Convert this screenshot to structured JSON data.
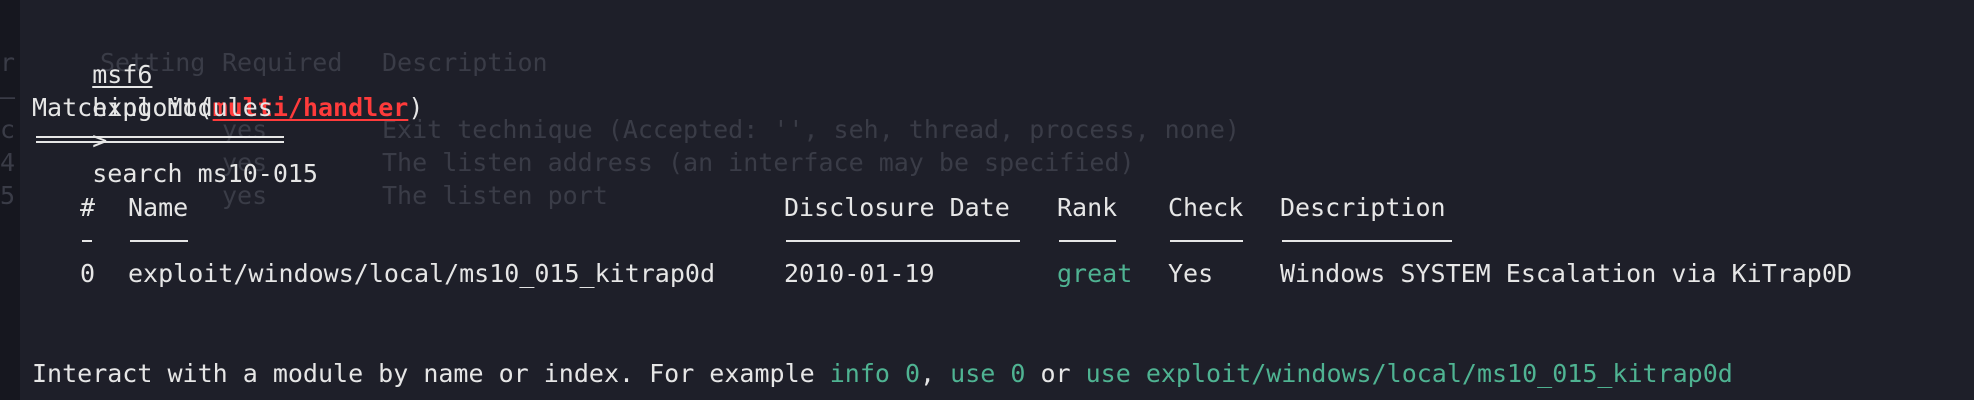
{
  "ghost": {
    "left_chars": [
      "r",
      "—",
      "c",
      "4",
      "5"
    ],
    "h_setting": "Setting",
    "h_required": "Required",
    "h_description": "Description",
    "rows": [
      {
        "req": "yes",
        "desc": "Exit technique (Accepted: '', seh, thread, process, none)"
      },
      {
        "req": "yes",
        "desc": "The listen address (an interface may be specified)"
      },
      {
        "req": "yes",
        "desc": "The listen port"
      }
    ]
  },
  "prompt": {
    "msf": "msf6",
    "exploit_word": "exploit(",
    "module": "multi/handler",
    "close": ")",
    "arrow": ">",
    "command": "search ms10-015"
  },
  "title": "Matching Modules",
  "table": {
    "headers": {
      "num": "#",
      "name": "Name",
      "date": "Disclosure Date",
      "rank": "Rank",
      "check": "Check",
      "description": "Description"
    },
    "rows": [
      {
        "num": "0",
        "name": "exploit/windows/local/ms10_015_kitrap0d",
        "date": "2010-01-19",
        "rank": "great",
        "check": "Yes",
        "description": "Windows SYSTEM Escalation via KiTrap0D"
      }
    ]
  },
  "footer": {
    "prefix": "Interact with a module by name or index. For example ",
    "cmd1": "info 0",
    "sep1": ", ",
    "cmd2": "use 0",
    "sep2": " or ",
    "cmd3": "use exploit/windows/local/ms10_015_kitrap0d"
  },
  "colors": {
    "background": "#1e1f29",
    "text": "#e6e6e6",
    "module_red": "#ff3b3b",
    "highlight_green": "#4fb392",
    "ghost_text": "#3a3c47"
  }
}
